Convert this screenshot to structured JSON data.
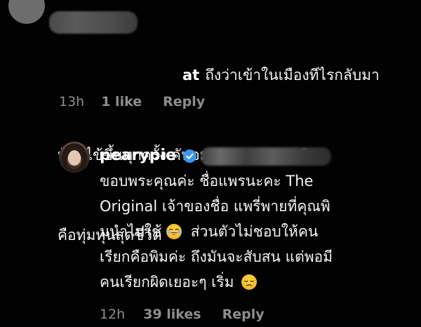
{
  "top_comment": {
    "username_visible_suffix": "at",
    "text_lines": [
      "ถึงว่าเข้าในเมืองทีไรกลับมา",
      "บ้านไข้ขึ้นทุกครั้ง คันจมูกมากๆค่ะ คุณพิม",
      "คือทุ่มทุนสุดชีวิต"
    ],
    "time": "13h",
    "likes": "1 like",
    "reply_label": "Reply"
  },
  "reply_comment": {
    "username": "pearypie",
    "verified": true,
    "text_lines": [
      "ขอบพระคุณค่ะ ชื่อแพรนะคะ The",
      "Original เจ้าของชื่อ แพรี่พายที่คุณพิ",
      "มนำไปใช้",
      "ส่วนตัวไม่ชอบให้คน",
      "เรียกคือพิมค่ะ ถึงมันจะสับสน แต่พอมี",
      "คนเรียกผิดเยอะๆ เริ่ม"
    ],
    "emojis": [
      "laughing-tears-emoji",
      "disappointed-face-emoji"
    ],
    "time": "12h",
    "likes": "39 likes",
    "reply_label": "Reply"
  },
  "colors": {
    "background": "#000000",
    "text": "#f5f5f5",
    "meta": "#8e8e8e",
    "verified_badge": "#3797f0"
  }
}
